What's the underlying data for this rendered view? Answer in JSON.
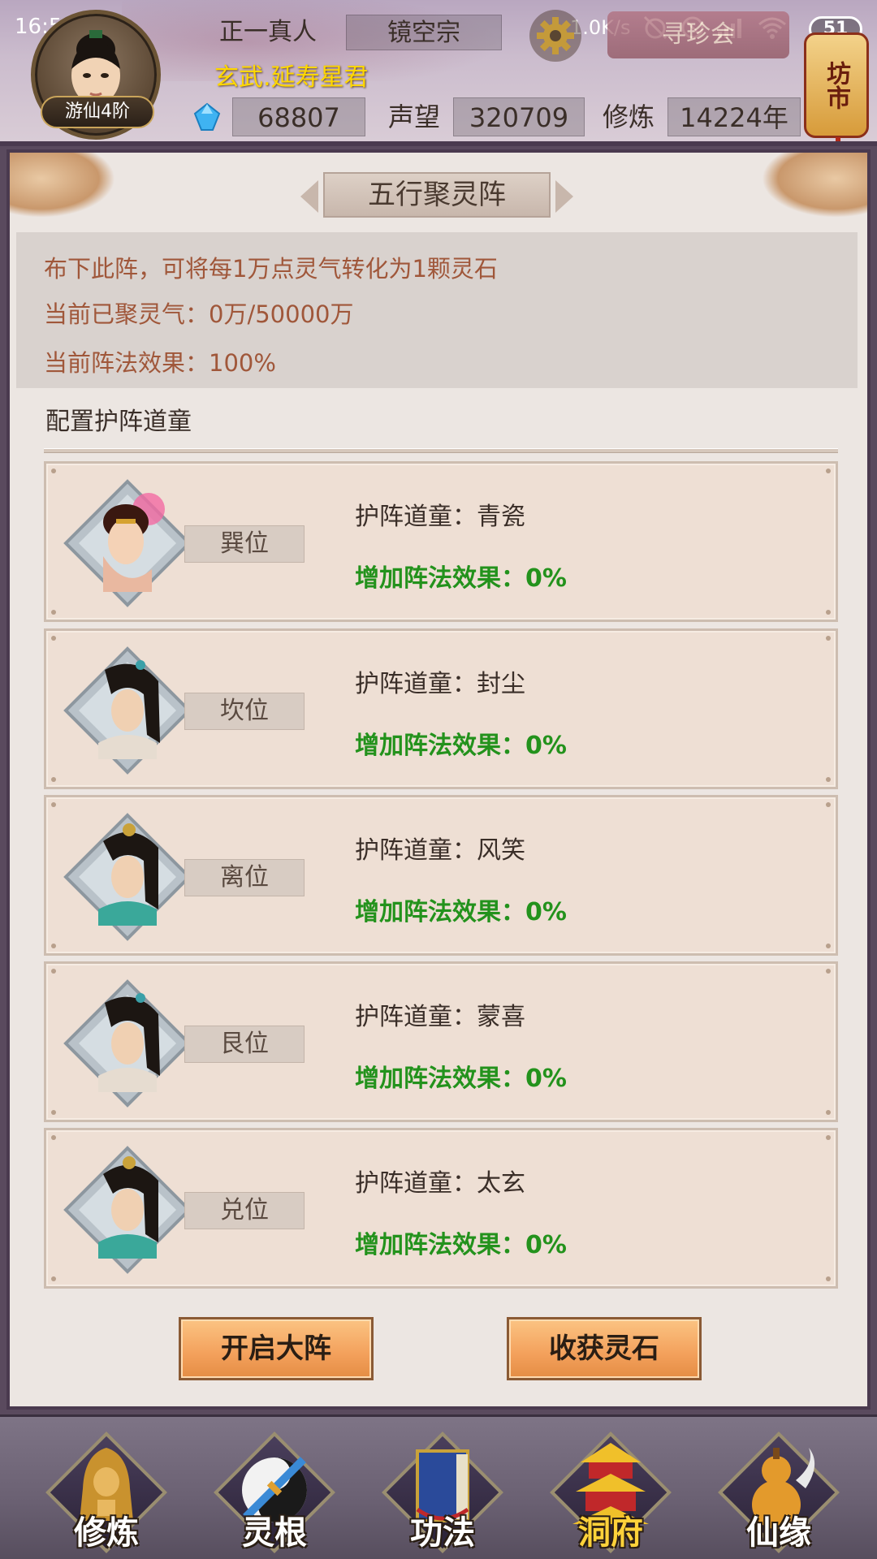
{
  "status_bar": {
    "time": "16:59",
    "network_speed": "1.0K/s",
    "battery": "51"
  },
  "player": {
    "name": "正一真人",
    "sect": "镜空宗",
    "title": "玄武.延寿星君",
    "rank": "游仙4阶",
    "spirit_stones": "68807",
    "prestige_label": "声望",
    "prestige": "320709",
    "cultivation_label": "修炼",
    "cultivation": "14224年"
  },
  "header_buttons": {
    "guild_label": "寻珍会",
    "market_label": "坊市"
  },
  "panel": {
    "title": "五行聚灵阵",
    "info_lines": [
      "布下此阵，可将每1万点灵气转化为1颗灵石",
      "当前已聚灵气：0万/50000万",
      "当前阵法效果：100%"
    ],
    "section_label": "配置护阵道童",
    "slots": [
      {
        "position": "巽位",
        "guard": "护阵道童：青瓷",
        "bonus": "增加阵法效果：0%"
      },
      {
        "position": "坎位",
        "guard": "护阵道童：封尘",
        "bonus": "增加阵法效果：0%"
      },
      {
        "position": "离位",
        "guard": "护阵道童：风笑",
        "bonus": "增加阵法效果：0%"
      },
      {
        "position": "艮位",
        "guard": "护阵道童：蒙喜",
        "bonus": "增加阵法效果：0%"
      },
      {
        "position": "兑位",
        "guard": "护阵道童：太玄",
        "bonus": "增加阵法效果：0%"
      }
    ],
    "buttons": {
      "activate": "开启大阵",
      "harvest": "收获灵石"
    }
  },
  "bottom_nav": [
    {
      "label": "修炼",
      "icon": "monk-icon",
      "active": false
    },
    {
      "label": "灵根",
      "icon": "yin-yang-sword-icon",
      "active": false
    },
    {
      "label": "功法",
      "icon": "book-icon",
      "active": false
    },
    {
      "label": "洞府",
      "icon": "pagoda-icon",
      "active": true
    },
    {
      "label": "仙缘",
      "icon": "gourd-icon",
      "active": false
    }
  ],
  "colors": {
    "info_text": "#a0573a",
    "bonus_text": "#23921c",
    "title_gold": "#ffd700",
    "button_orange": "#f3a05b"
  }
}
